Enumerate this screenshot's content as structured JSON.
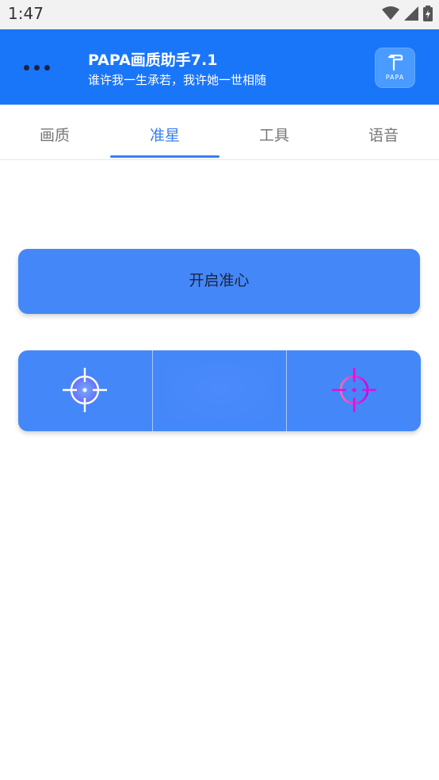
{
  "status_bar": {
    "time": "1:47",
    "icons": [
      "wifi-icon",
      "signal-icon",
      "battery-charging-icon"
    ]
  },
  "header": {
    "title": "PAPA画质助手7.1",
    "subtitle": "谁许我一生承若，我许她一世相随",
    "logo_text": "PAPA",
    "menu_icon": "more-dots-icon",
    "background_color": "#1a76f9"
  },
  "tabs": [
    {
      "label": "画质",
      "active": false
    },
    {
      "label": "准星",
      "active": true
    },
    {
      "label": "工具",
      "active": false
    },
    {
      "label": "语音",
      "active": false
    }
  ],
  "main": {
    "primary_button_label": "开启准心",
    "crosshair_options": [
      {
        "icon": "white-crosshair-icon",
        "color": "#ffffff"
      },
      {
        "icon": "empty-slot"
      },
      {
        "icon": "magenta-crosshair-icon",
        "color": "#e020e0"
      }
    ]
  },
  "colors": {
    "accent": "#3a7ff0",
    "button_fill": "#4487f8"
  }
}
